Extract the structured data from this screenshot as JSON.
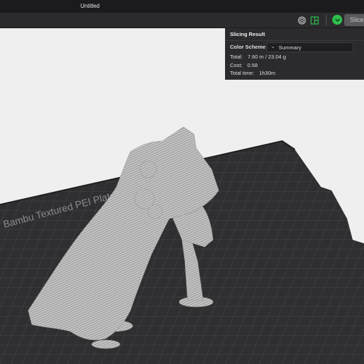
{
  "window": {
    "title": "Untitled"
  },
  "toolbar": {
    "icons": [
      "layers-view-icon",
      "object-list-icon"
    ],
    "slice_icon": "chevron-down-icon",
    "slice_label": "Slice"
  },
  "bed": {
    "label": "Bambu Textured PEI Plate / High Temp"
  },
  "slicing_result": {
    "header": "Slicing Result",
    "color_scheme_label": "Color Scheme",
    "color_scheme_value": "Summary",
    "total_label": "Total:",
    "total_value": "7.60 m / 23.04 g",
    "cost_label": "Cost:",
    "cost_value": "0.58",
    "time_label": "Total time:",
    "time_value": "1h30m"
  },
  "colors": {
    "accent": "#2ec04b",
    "bed": "#2f2f31",
    "model": "#b9b9b9"
  }
}
